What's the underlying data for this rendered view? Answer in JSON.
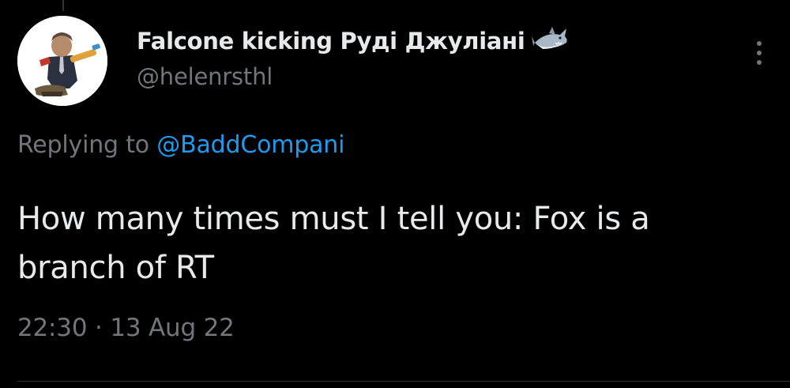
{
  "tweet": {
    "author": {
      "display_name": "Falcone kicking Руді Джуліані",
      "display_name_emoji": "shark-emoji",
      "handle": "@helenrsthl",
      "avatar": "avatar-image"
    },
    "replying_prefix": "Replying to",
    "replying_to": "@BaddCompani",
    "text_line_1": "How many times must I tell you: Fox is a",
    "text_line_2": "branch of RT",
    "time": "22:30",
    "separator": "·",
    "date": "13 Aug 22",
    "more_icon": "more-vertical-icon"
  },
  "colors": {
    "background": "#000000",
    "primary_text": "#e7e9ea",
    "secondary_text": "#71767b",
    "link": "#1d9bf0",
    "divider": "#2f3336"
  }
}
